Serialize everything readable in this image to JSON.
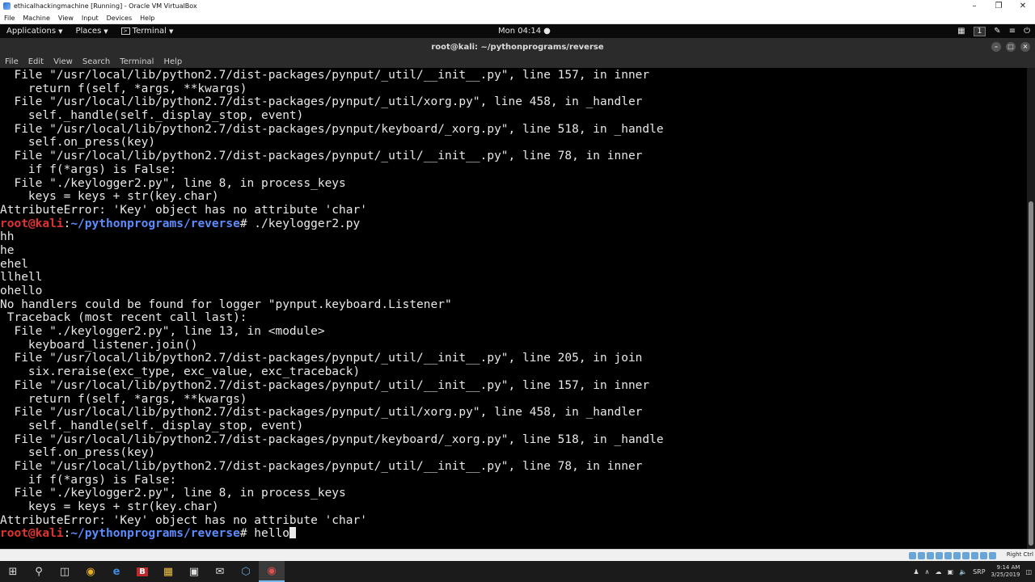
{
  "vbox": {
    "title": "ethicalhackingmachine [Running] - Oracle VM VirtualBox",
    "menu": [
      "File",
      "Machine",
      "View",
      "Input",
      "Devices",
      "Help"
    ]
  },
  "gnome_bar": {
    "applications": "Applications",
    "places": "Places",
    "terminal": "Terminal",
    "clock": "Mon 04:14",
    "workspace": "1"
  },
  "terminal_window": {
    "title": "root@kali: ~/pythonprograms/reverse",
    "menu": [
      "File",
      "Edit",
      "View",
      "Search",
      "Terminal",
      "Help"
    ]
  },
  "prompt": {
    "user_host": "root@kali",
    "sep": ":",
    "path": "~/pythonprograms/reverse",
    "symbol": "# "
  },
  "lines": [
    {
      "text": "  File \"/usr/local/lib/python2.7/dist-packages/pynput/_util/__init__.py\", line 157, in inner"
    },
    {
      "text": "    return f(self, *args, **kwargs)"
    },
    {
      "text": "  File \"/usr/local/lib/python2.7/dist-packages/pynput/_util/xorg.py\", line 458, in _handler"
    },
    {
      "text": "    self._handle(self._display_stop, event)"
    },
    {
      "text": "  File \"/usr/local/lib/python2.7/dist-packages/pynput/keyboard/_xorg.py\", line 518, in _handle"
    },
    {
      "text": "    self.on_press(key)"
    },
    {
      "text": "  File \"/usr/local/lib/python2.7/dist-packages/pynput/_util/__init__.py\", line 78, in inner"
    },
    {
      "text": "    if f(*args) is False:"
    },
    {
      "text": "  File \"./keylogger2.py\", line 8, in process_keys"
    },
    {
      "text": "    keys = keys + str(key.char)"
    },
    {
      "text": "AttributeError: 'Key' object has no attribute 'char'"
    },
    {
      "prompt": true,
      "text": "./keylogger2.py"
    },
    {
      "text": "hh"
    },
    {
      "text": "he"
    },
    {
      "text": "ehel"
    },
    {
      "text": "llhell"
    },
    {
      "text": "ohello"
    },
    {
      "text": "No handlers could be found for logger \"pynput.keyboard.Listener\""
    },
    {
      "text": " Traceback (most recent call last):"
    },
    {
      "text": "  File \"./keylogger2.py\", line 13, in <module>"
    },
    {
      "text": "    keyboard_listener.join()"
    },
    {
      "text": "  File \"/usr/local/lib/python2.7/dist-packages/pynput/_util/__init__.py\", line 205, in join"
    },
    {
      "text": "    six.reraise(exc_type, exc_value, exc_traceback)"
    },
    {
      "text": "  File \"/usr/local/lib/python2.7/dist-packages/pynput/_util/__init__.py\", line 157, in inner"
    },
    {
      "text": "    return f(self, *args, **kwargs)"
    },
    {
      "text": "  File \"/usr/local/lib/python2.7/dist-packages/pynput/_util/xorg.py\", line 458, in _handler"
    },
    {
      "text": "    self._handle(self._display_stop, event)"
    },
    {
      "text": "  File \"/usr/local/lib/python2.7/dist-packages/pynput/keyboard/_xorg.py\", line 518, in _handle"
    },
    {
      "text": "    self.on_press(key)"
    },
    {
      "text": "  File \"/usr/local/lib/python2.7/dist-packages/pynput/_util/__init__.py\", line 78, in inner"
    },
    {
      "text": "    if f(*args) is False:"
    },
    {
      "text": "  File \"./keylogger2.py\", line 8, in process_keys"
    },
    {
      "text": "    keys = keys + str(key.char)"
    },
    {
      "text": "AttributeError: 'Key' object has no attribute 'char'"
    },
    {
      "prompt": true,
      "text": "hello",
      "cursor": true
    }
  ],
  "status_bar": {
    "host_key": "Right Ctrl"
  },
  "taskbar": {
    "apps": [
      "start-icon",
      "search-icon",
      "task-view-icon",
      "chrome-icon",
      "edge-icon",
      "app-b-icon",
      "file-explorer-icon",
      "store-icon",
      "mail-icon",
      "virtualbox-icon",
      "recorder-icon"
    ],
    "tray_lang": "SRP",
    "time": "9:14 AM",
    "date": "3/25/2019"
  },
  "colors": {
    "prompt_user": "#e23232",
    "prompt_path": "#5c8cff",
    "terminal_bg": "#000000",
    "terminal_fg": "#e8e8e8"
  }
}
